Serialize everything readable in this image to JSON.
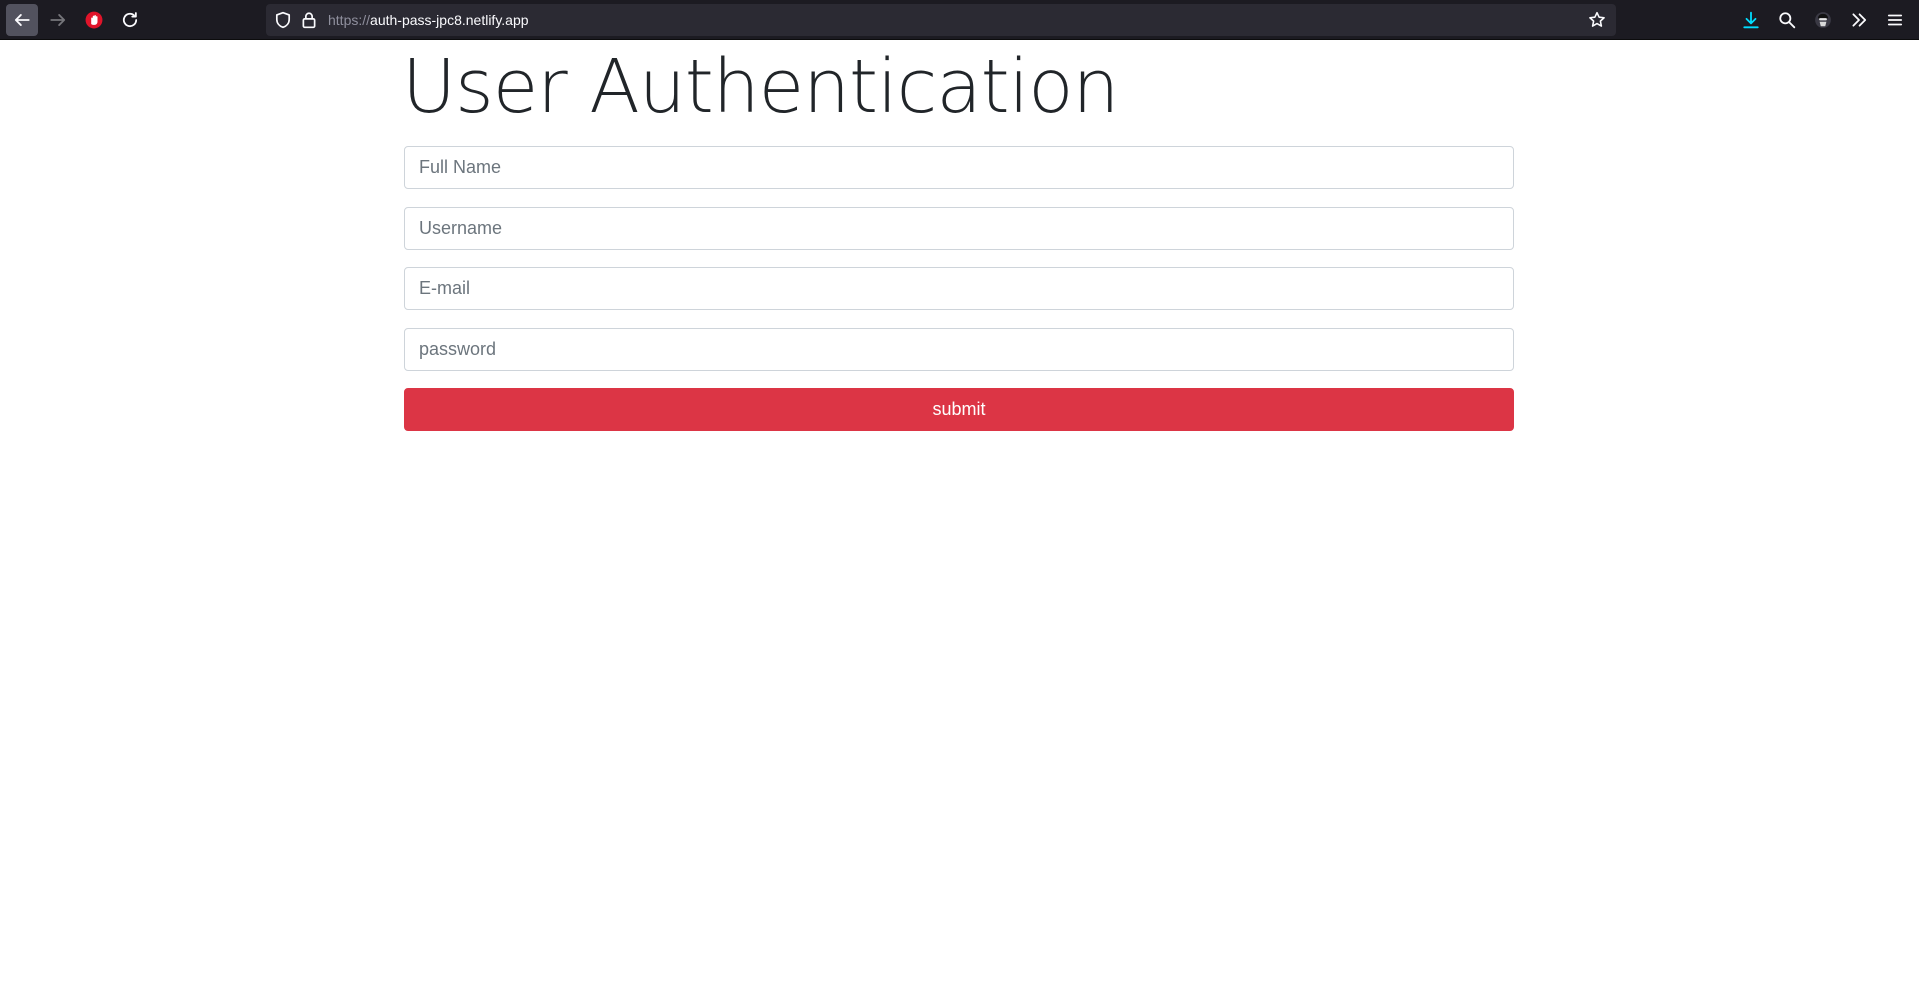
{
  "browser": {
    "url_scheme": "https://",
    "url_host": "auth-pass-jpc8.netlify.app",
    "icons": {
      "back": "arrow-left-icon",
      "forward": "arrow-right-icon",
      "extension": "hand-stop-icon",
      "reload": "reload-icon",
      "shield": "shield-icon",
      "lock": "lock-icon",
      "bookmark": "star-icon",
      "downloads": "download-icon",
      "search": "search-icon",
      "account": "avatar-icon",
      "overflow": "chevron-double-right-icon",
      "menu": "hamburger-menu-icon"
    },
    "colors": {
      "toolbar_bg": "#1c1b22",
      "urlbar_bg": "#2b2a33",
      "download_accent": "#00ddff",
      "extension_red": "#e0142a"
    }
  },
  "page": {
    "title": "User Authentication",
    "form": {
      "full_name_placeholder": "Full Name",
      "username_placeholder": "Username",
      "email_placeholder": "E-mail",
      "password_placeholder": "password",
      "submit_label": "submit"
    },
    "colors": {
      "submit_bg": "#dc3545",
      "title_text": "#212529",
      "input_border": "#ced4da"
    }
  }
}
